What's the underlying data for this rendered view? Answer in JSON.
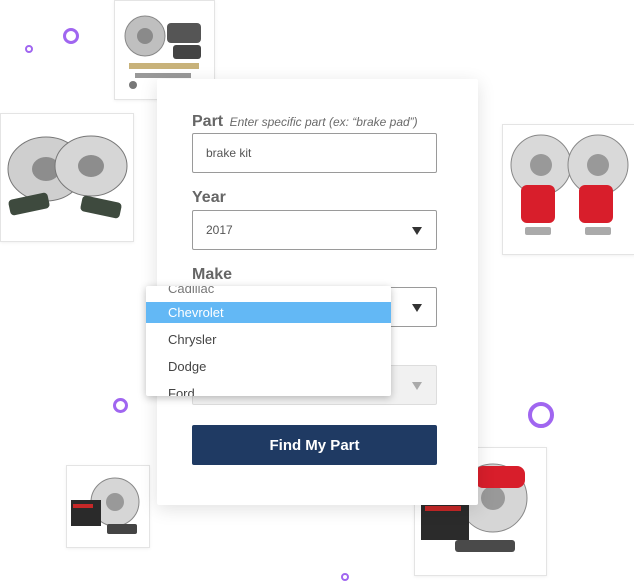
{
  "form": {
    "part_label": "Part",
    "part_hint": "Enter specific part (ex: “brake pad”)",
    "part_value": "brake kit",
    "year_label": "Year",
    "year_value": "2017",
    "make_label": "Make",
    "submit_label": "Find My Part"
  },
  "make_dropdown": {
    "options": [
      "Cadillac",
      "Chevrolet",
      "Chrysler",
      "Dodge",
      "Ford"
    ],
    "highlighted": "Chevrolet"
  },
  "colors": {
    "button": "#1f3a63",
    "highlight": "#63b8f5",
    "accent_ring": "#a066f0"
  },
  "product_tiles": [
    {
      "icon": "brake-hardware-kit-icon"
    },
    {
      "icon": "drilled-rotors-pads-icon"
    },
    {
      "icon": "red-caliper-rotors-icon"
    },
    {
      "icon": "brake-kit-box-icon"
    },
    {
      "icon": "evolution-caliper-kit-icon"
    }
  ]
}
